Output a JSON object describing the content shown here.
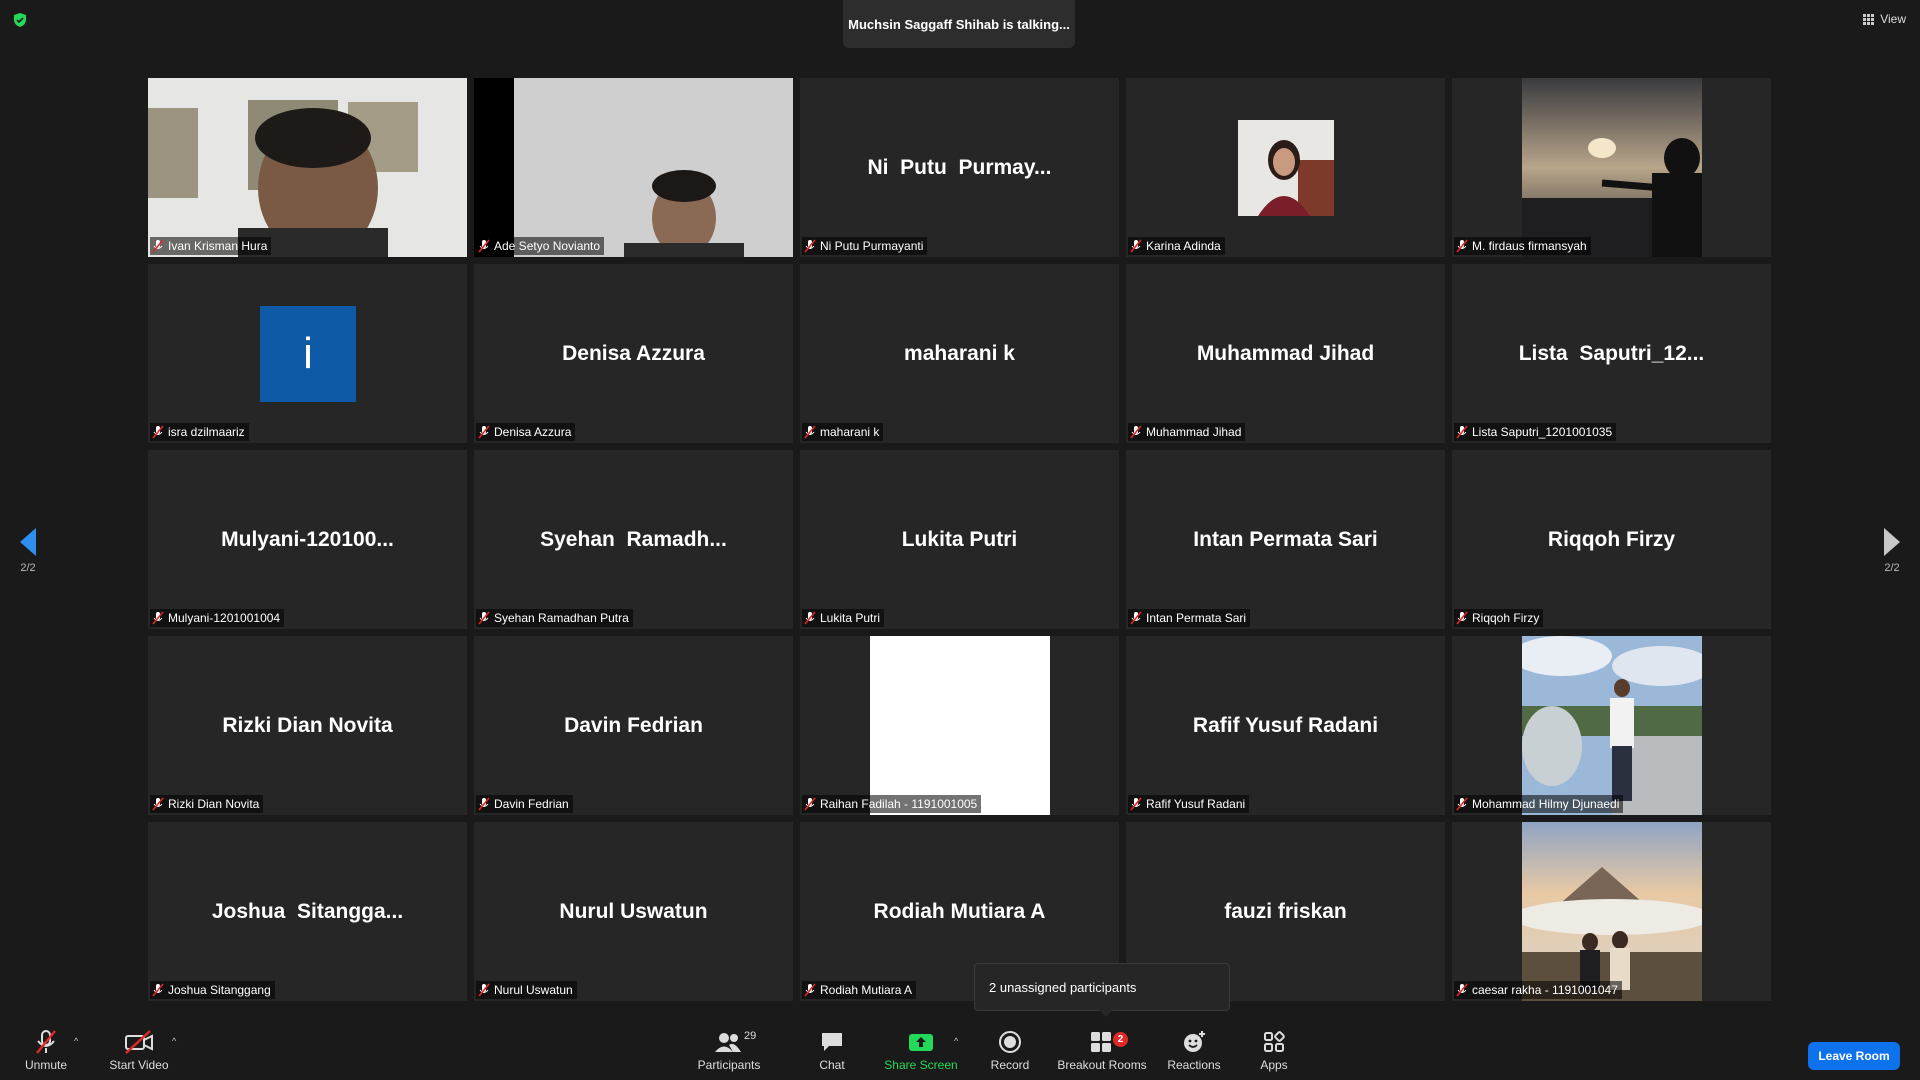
{
  "header": {
    "talking": "Muchsin Saggaff Shihab is talking...",
    "view_label": "View"
  },
  "pager": {
    "left": "2/2",
    "right": "2/2"
  },
  "tiles": [
    {
      "big": "",
      "name": "Ivan Krisman Hura"
    },
    {
      "big": "",
      "name": "Ade Setyo Novianto"
    },
    {
      "big": "Ni  Putu  Purmay...",
      "name": "Ni Putu Purmayanti"
    },
    {
      "big": "",
      "name": "Karina Adinda"
    },
    {
      "big": "",
      "name": "M. firdaus firmansyah"
    },
    {
      "big": "",
      "name": "isra dzilmaariz",
      "avatar_letter": "i"
    },
    {
      "big": "Denisa Azzura",
      "name": "Denisa Azzura"
    },
    {
      "big": "maharani k",
      "name": "maharani k"
    },
    {
      "big": "Muhammad Jihad",
      "name": "Muhammad Jihad"
    },
    {
      "big": "Lista  Saputri_12...",
      "name": "Lista Saputri_1201001035"
    },
    {
      "big": "Mulyani-120100...",
      "name": "Mulyani-1201001004"
    },
    {
      "big": "Syehan  Ramadh...",
      "name": "Syehan Ramadhan Putra"
    },
    {
      "big": "Lukita Putri",
      "name": "Lukita Putri"
    },
    {
      "big": "Intan Permata Sari",
      "name": "Intan Permata Sari"
    },
    {
      "big": "Riqqoh Firzy",
      "name": "Riqqoh Firzy"
    },
    {
      "big": "Rizki Dian Novita",
      "name": "Rizki Dian Novita"
    },
    {
      "big": "Davin Fedrian",
      "name": "Davin Fedrian"
    },
    {
      "big": "",
      "name": "Raihan Fadilah - 1191001005"
    },
    {
      "big": "Rafif Yusuf Radani",
      "name": "Rafif Yusuf Radani"
    },
    {
      "big": "",
      "name": "Mohammad Hilmy Djunaedi"
    },
    {
      "big": "Joshua  Sitangga...",
      "name": "Joshua Sitanggang"
    },
    {
      "big": "Nurul Uswatun",
      "name": "Nurul Uswatun"
    },
    {
      "big": "Rodiah Mutiara A",
      "name": "Rodiah Mutiara A"
    },
    {
      "big": "fauzi friskan",
      "name": ""
    },
    {
      "big": "",
      "name": "caesar rakha - 1191001047"
    }
  ],
  "popup": {
    "text": "2 unassigned participants"
  },
  "toolbar": {
    "unmute": "Unmute",
    "start_video": "Start Video",
    "participants": "Participants",
    "participants_count": "29",
    "chat": "Chat",
    "share_screen": "Share Screen",
    "record": "Record",
    "breakout_rooms": "Breakout Rooms",
    "breakout_badge": "2",
    "reactions": "Reactions",
    "apps": "Apps",
    "leave_room": "Leave Room"
  },
  "colors": {
    "accent": "#0e72ed",
    "share_green": "#23d959",
    "badge_red": "#e02828",
    "tile_bg": "#262626",
    "avatar_blue": "#0e5aa7"
  }
}
